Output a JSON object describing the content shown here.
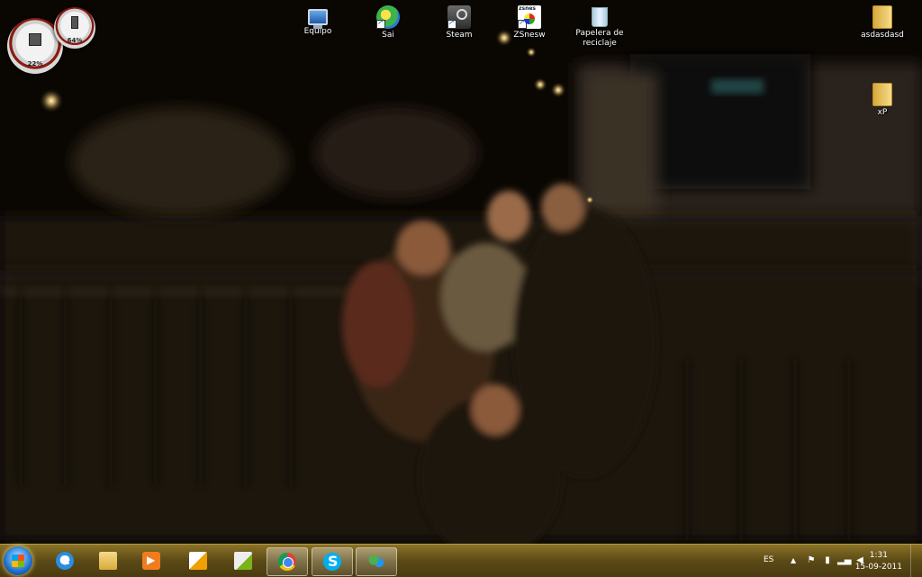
{
  "desktop": {
    "icons": [
      {
        "label": "Equipo",
        "icon": "computer-icon"
      },
      {
        "label": "Sai",
        "icon": "sai-icon"
      },
      {
        "label": "Steam",
        "icon": "steam-icon"
      },
      {
        "label": "ZSnesw",
        "icon": "zsnes-icon"
      },
      {
        "label": "Papelera de reciclaje",
        "icon": "recycle-bin-icon"
      },
      {
        "label": "asdasdasd",
        "icon": "folder-icon"
      },
      {
        "label": "xP",
        "icon": "folder-icon"
      }
    ]
  },
  "gadget": {
    "cpu_label": "22%",
    "cpu_percent": 22,
    "memory_label": "64%",
    "memory_percent": 64
  },
  "taskbar": {
    "buttons": [
      {
        "name": "internet-explorer",
        "icon": "ie-icon",
        "active": false
      },
      {
        "name": "windows-explorer",
        "icon": "folder-icon",
        "active": false
      },
      {
        "name": "media-player",
        "icon": "media-player-icon",
        "active": false
      },
      {
        "name": "sai",
        "icon": "sai-icon",
        "active": false
      },
      {
        "name": "drawing-app",
        "icon": "pencil-icon",
        "active": false
      },
      {
        "name": "chrome",
        "icon": "chrome-icon",
        "active": true
      },
      {
        "name": "skype",
        "icon": "skype-icon",
        "active": true
      },
      {
        "name": "messenger",
        "icon": "messenger-icon",
        "active": true
      }
    ],
    "tray": {
      "language": "ES",
      "time": "1:31",
      "date": "15-09-2011"
    }
  },
  "colors": {
    "taskbar": "#5b4a16",
    "wallpaper_base": "#0b0804"
  }
}
